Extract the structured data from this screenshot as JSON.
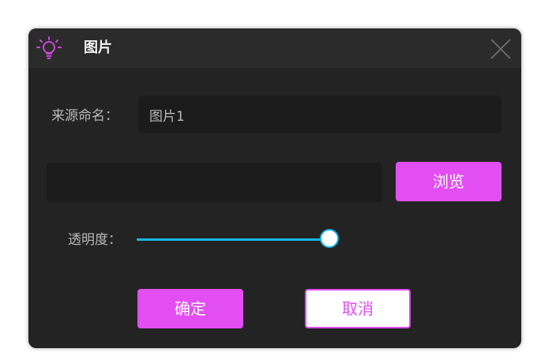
{
  "dialog": {
    "title": "图片",
    "title_icon": "lightbulb-icon",
    "close_icon": "close-icon"
  },
  "form": {
    "name_label": "来源命名：",
    "name_value": "图片1",
    "path_value": "",
    "browse_label": "浏览",
    "opacity_label": "透明度：",
    "opacity_value": 0.94
  },
  "actions": {
    "ok_label": "确定",
    "cancel_label": "取消"
  },
  "colors": {
    "accent": "#e24ef2",
    "slider": "#16b6e0",
    "background": "#232323",
    "titlebar": "#2b2b2b",
    "input": "#1b1b1b"
  }
}
